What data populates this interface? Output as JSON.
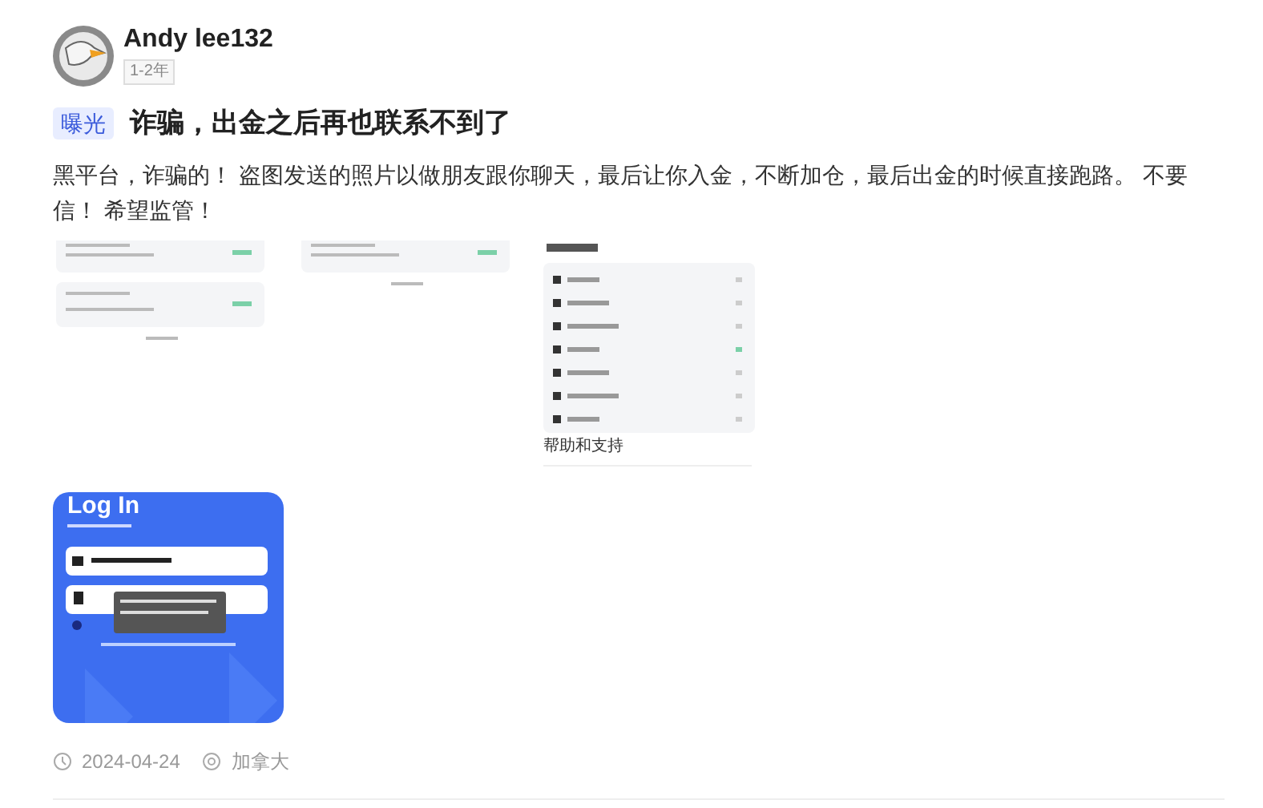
{
  "author": {
    "name": "Andy lee132",
    "tenure": "1-2年"
  },
  "post": {
    "tag": "曝光",
    "title": "诈骗，出金之后再也联系不到了",
    "body": "黑平台，诈骗的！ 盗图发送的照片以做朋友跟你聊天，最后让你入金，不断加仓，最后出金的时候直接跑路。 不要信！ 希望监管！",
    "images": [
      {
        "kind": "two-cards"
      },
      {
        "kind": "one-card"
      },
      {
        "kind": "settings",
        "caption": "帮助和支持"
      },
      {
        "kind": "login",
        "title": "Log In"
      }
    ],
    "date": "2024-04-24",
    "location": "加拿大"
  }
}
